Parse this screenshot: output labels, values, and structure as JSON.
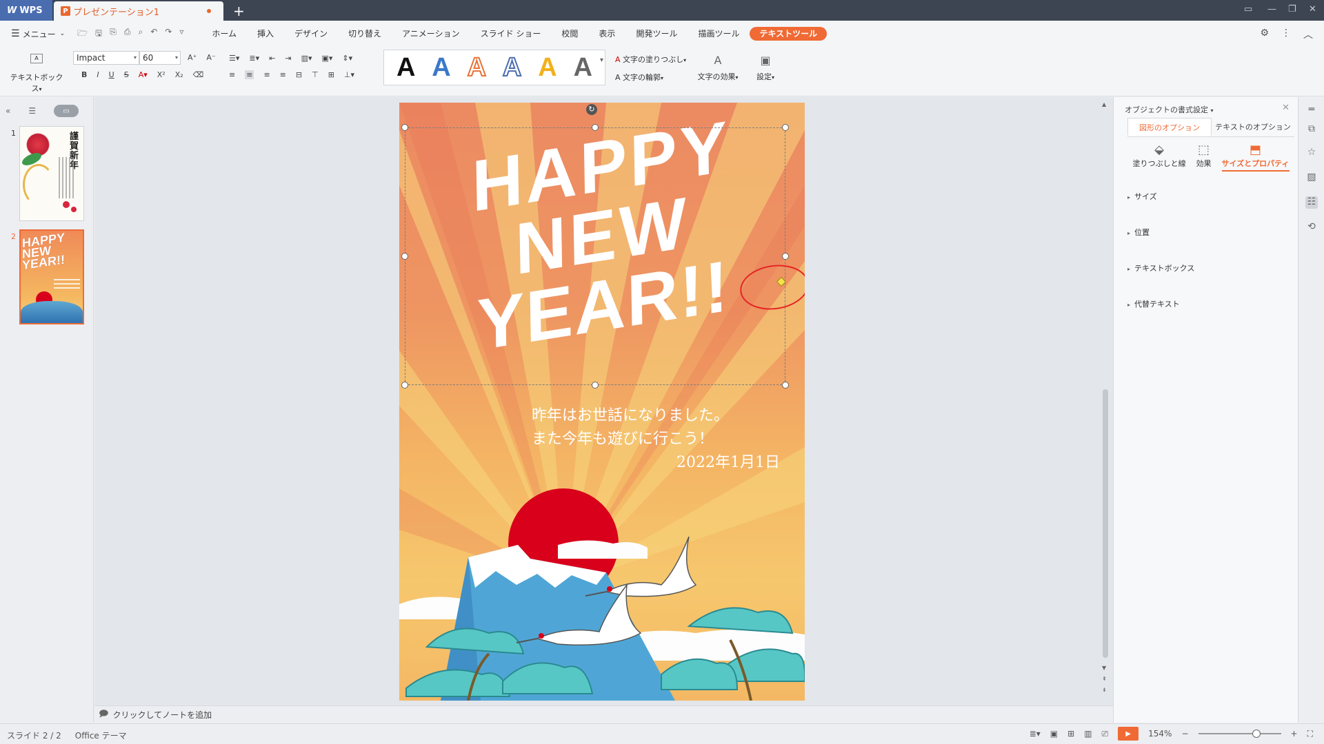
{
  "titlebar": {
    "app_name": "WPS",
    "doc_tab": "プレゼンテーション1",
    "new_tab": "+"
  },
  "menubar": {
    "menu_label": "メニュー",
    "tabs": [
      {
        "label": "ホーム"
      },
      {
        "label": "挿入"
      },
      {
        "label": "デザイン"
      },
      {
        "label": "切り替え"
      },
      {
        "label": "アニメーション"
      },
      {
        "label": "スライド ショー"
      },
      {
        "label": "校閲"
      },
      {
        "label": "表示"
      },
      {
        "label": "開発ツール"
      },
      {
        "label": "描画ツール"
      },
      {
        "label": "テキストツール"
      }
    ]
  },
  "ribbon": {
    "textbox_label": "テキストボックス",
    "font_name": "Impact",
    "font_size": "60",
    "style_glyph": "A",
    "fill_label": "文字の塗りつぶし",
    "outline_label": "文字の輪郭",
    "effect_label": "文字の効果",
    "settings_label": "設定"
  },
  "thumbnails": [
    {
      "number": "1",
      "title": "謹賀新年"
    },
    {
      "number": "2",
      "title_lines": [
        "HAPPY",
        "NEW",
        "YEAR!!"
      ]
    }
  ],
  "slide": {
    "title_lines": [
      "HAPPY",
      "NEW",
      "YEAR!!"
    ],
    "greeting_lines": [
      "昨年はお世話になりました。",
      "また今年も遊びに行こう！",
      "2022年1月1日"
    ]
  },
  "notes": {
    "placeholder": "クリックしてノートを追加"
  },
  "rightpanel": {
    "title": "オブジェクトの書式設定",
    "tabs": [
      "図形のオプション",
      "テキストのオプション"
    ],
    "sub_options": [
      "塗りつぶしと線",
      "効果",
      "サイズとプロパティ"
    ],
    "sections": [
      "サイズ",
      "位置",
      "テキストボックス",
      "代替テキスト"
    ]
  },
  "statusbar": {
    "slide_counter": "スライド 2 / 2",
    "theme": "Office テーマ",
    "zoom": "154%"
  },
  "colors": {
    "accent": "#f06a35",
    "titlebar": "#3d4553",
    "sun": "#d8001b"
  }
}
